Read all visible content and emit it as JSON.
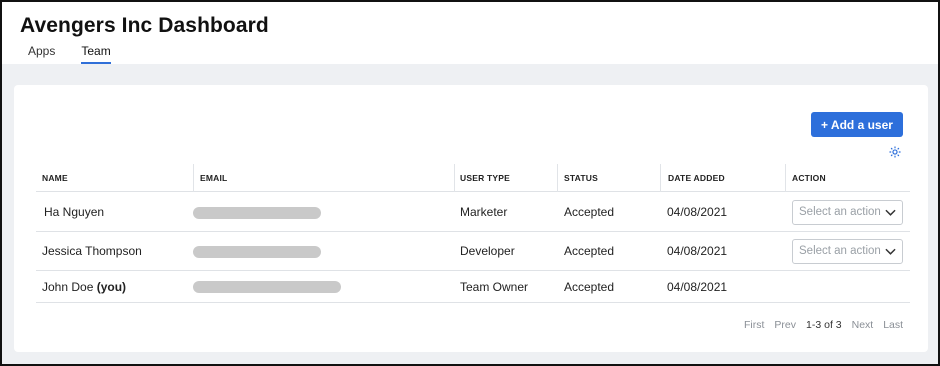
{
  "header": {
    "title": "Avengers Inc Dashboard",
    "tabs": [
      {
        "label": "Apps",
        "active": false
      },
      {
        "label": "Team",
        "active": true
      }
    ]
  },
  "toolbar": {
    "add_user_label": "+ Add a user",
    "settings_icon": "gear-icon"
  },
  "table": {
    "columns": [
      "NAME",
      "EMAIL",
      "USER TYPE",
      "STATUS",
      "DATE ADDED",
      "ACTION"
    ],
    "rows": [
      {
        "name": "Ha Nguyen",
        "name_suffix": "",
        "user_type": "Marketer",
        "status": "Accepted",
        "date_added": "04/08/2021",
        "action_placeholder": "Select an action"
      },
      {
        "name": "Jessica Thompson",
        "name_suffix": "",
        "user_type": "Developer",
        "status": "Accepted",
        "date_added": "04/08/2021",
        "action_placeholder": "Select an action"
      },
      {
        "name": "John Doe",
        "name_suffix": "(you)",
        "user_type": "Team Owner",
        "status": "Accepted",
        "date_added": "04/08/2021",
        "action_placeholder": null
      }
    ]
  },
  "pagination": {
    "first": "First",
    "prev": "Prev",
    "range": "1-3 of 3",
    "next": "Next",
    "last": "Last"
  },
  "colors": {
    "accent": "#2d6fdb",
    "page_bg": "#eef0f3"
  }
}
